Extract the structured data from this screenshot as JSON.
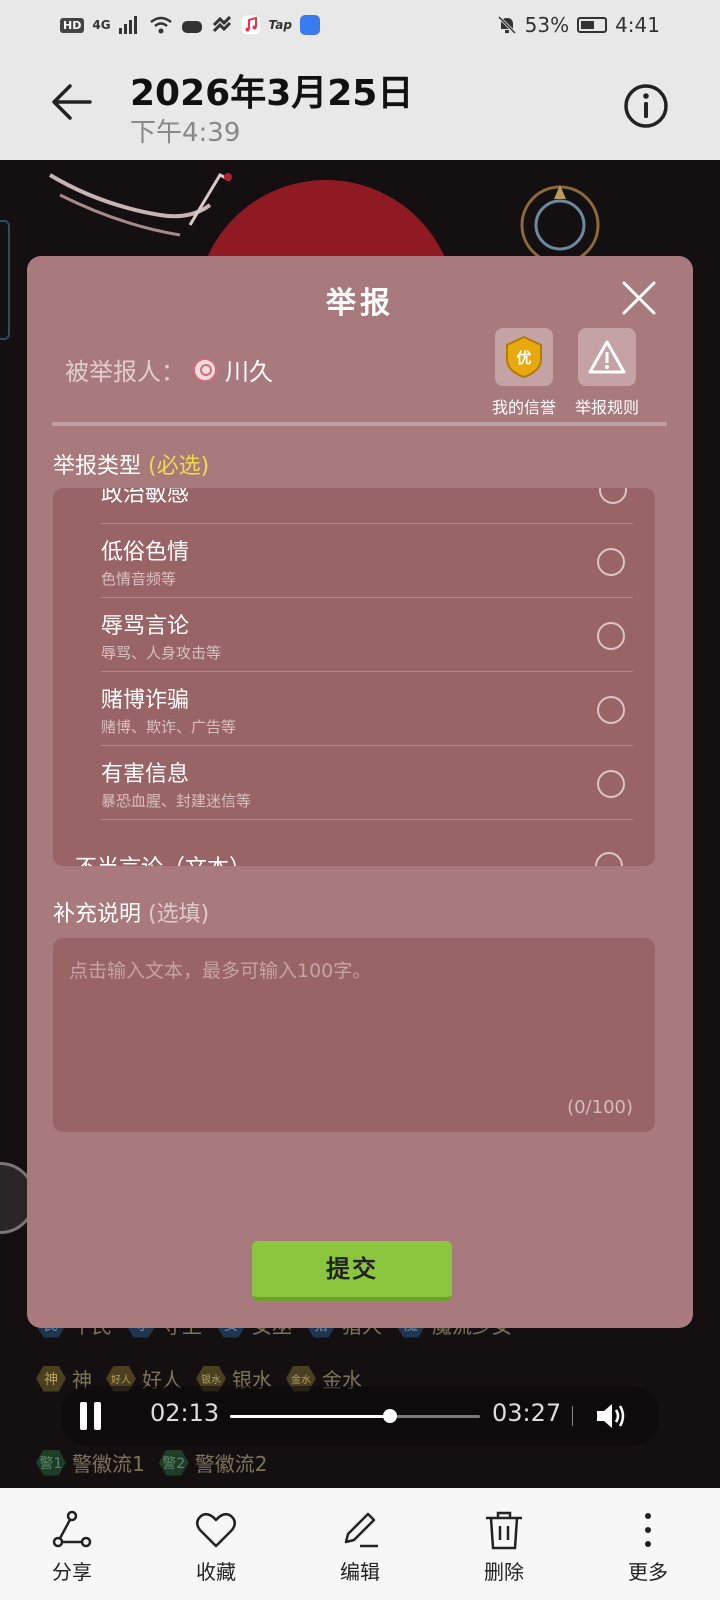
{
  "status_bar": {
    "network_badge": "HD",
    "network_type": "4G",
    "tap_label": "Tap",
    "battery": "53%",
    "time": "4:41"
  },
  "header": {
    "date": "2026年3月25日",
    "time": "下午4:39"
  },
  "report_dialog": {
    "title": "举报",
    "reported_label": "被举报人：",
    "reported_name": "川久",
    "my_credit_label": "我的信誉",
    "my_credit_badge": "优",
    "report_rules_label": "举报规则",
    "type_label": "举报类型",
    "type_required": "(必选)",
    "partial_top_option": "政治敏感",
    "options": [
      {
        "title": "低俗色情",
        "subtitle": "色情音频等"
      },
      {
        "title": "辱骂言论",
        "subtitle": "辱骂、人身攻击等"
      },
      {
        "title": "赌博诈骗",
        "subtitle": "赌博、欺诈、广告等"
      },
      {
        "title": "有害信息",
        "subtitle": "暴恐血腥、封建迷信等"
      }
    ],
    "partial_bottom_option": "不当言论（文本）",
    "extra_label": "补充说明",
    "extra_optional": "(选填)",
    "textarea_placeholder": "点击输入文本，最多可输入100字。",
    "char_count": "(0/100)",
    "submit_label": "提交"
  },
  "background_tags": {
    "row1": [
      {
        "badge": "民",
        "name": "平民",
        "color": "blue"
      },
      {
        "badge": "守",
        "name": "守卫",
        "color": "blue"
      },
      {
        "badge": "女",
        "name": "女巫",
        "color": "blue"
      },
      {
        "badge": "猎",
        "name": "猎人",
        "color": "blue"
      },
      {
        "badge": "魔",
        "name": "魔流少女",
        "color": "blue"
      }
    ],
    "row2": [
      {
        "badge": "神",
        "name": "神",
        "color": "olive"
      },
      {
        "badge": "好人",
        "name": "好人",
        "color": "olive"
      },
      {
        "badge": "银水",
        "name": "银水",
        "color": "olive"
      },
      {
        "badge": "金水",
        "name": "金水",
        "color": "olive"
      }
    ],
    "row3": [
      {
        "badge": "警1",
        "name": "警徽流1",
        "color": "green"
      },
      {
        "badge": "警2",
        "name": "警徽流2",
        "color": "green"
      }
    ]
  },
  "player": {
    "current_time": "02:13",
    "total_time": "03:27",
    "progress": 0.64
  },
  "bottom_actions": [
    {
      "label": "分享",
      "icon": "share-icon"
    },
    {
      "label": "收藏",
      "icon": "heart-icon"
    },
    {
      "label": "编辑",
      "icon": "edit-icon"
    },
    {
      "label": "删除",
      "icon": "trash-icon"
    },
    {
      "label": "更多",
      "icon": "more-icon"
    }
  ],
  "colors": {
    "dialog_bg": "#a87a7d",
    "required_text": "#f5d84a",
    "submit_bg": "#8cc63e"
  }
}
